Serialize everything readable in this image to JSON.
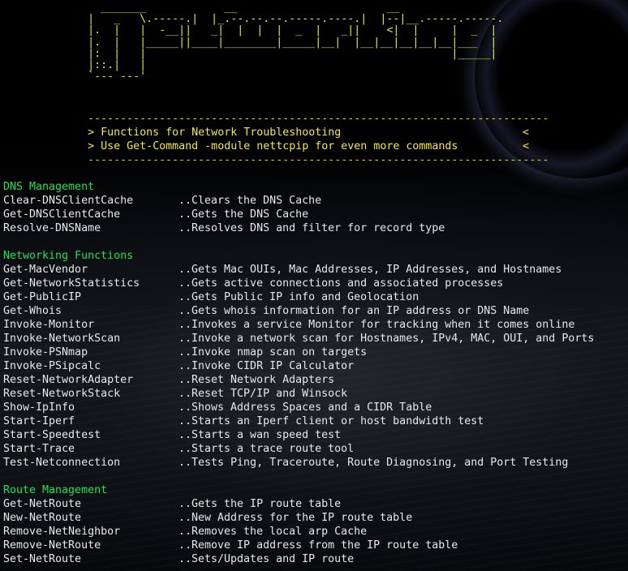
{
  "logo_lines": [
    "               _______            __                       __",
    "             |   _   \\.-----.|  |_.--.--.--.-----.----.|  |--|__.-----.-----.",
    "             |.  |   |  -__||   _|  |  |  |  _  |   _||    <|  |     |  _  |",
    "             |.  |   |_____||____|________|_____|__|  |__|__|__|__|__|___  |",
    "             |:  |   |                                               |_____|",
    "             |::.|   |",
    "             `--- ---'"
  ],
  "banner": {
    "separator": "             -----------------------------------------------------------------------",
    "row1_marker": "> ",
    "row1_text": "Functions for Network Troubleshooting",
    "row1_end": "<",
    "row2_marker": "> ",
    "row2_text": "Use Get-Command -module nettcpip for even more commands",
    "row2_end": "<"
  },
  "sections": [
    {
      "title": "DNS Management",
      "commands": [
        {
          "name": "Clear-DNSClientCache",
          "desc": "..Clears the DNS Cache"
        },
        {
          "name": "Get-DNSClientCache",
          "desc": "..Gets the DNS Cache"
        },
        {
          "name": "Resolve-DNSName",
          "desc": "..Resolves DNS and filter for record type"
        }
      ]
    },
    {
      "title": "Networking Functions",
      "commands": [
        {
          "name": "Get-MacVendor",
          "desc": "..Gets Mac OUIs, Mac Addresses, IP Addresses, and Hostnames"
        },
        {
          "name": "Get-NetworkStatistics",
          "desc": "..Gets active connections and associated processes"
        },
        {
          "name": "Get-PublicIP",
          "desc": "..Gets Public IP info and Geolocation"
        },
        {
          "name": "Get-Whois",
          "desc": "..Gets whois information for an IP address or DNS Name"
        },
        {
          "name": "Invoke-Monitor",
          "desc": "..Invokes a service Monitor for tracking when it comes online"
        },
        {
          "name": "Invoke-NetworkScan",
          "desc": "..Invoke a network scan for Hostnames, IPv4, MAC, OUI, and Ports"
        },
        {
          "name": "Invoke-PSNmap",
          "desc": "..Invoke nmap scan on targets"
        },
        {
          "name": "Invoke-PSipcalc",
          "desc": "..Invoke CIDR IP Calculator"
        },
        {
          "name": "Reset-NetworkAdapter",
          "desc": "..Reset Network Adapters"
        },
        {
          "name": "Reset-NetworkStack",
          "desc": "..Reset TCP/IP and Winsock"
        },
        {
          "name": "Show-IpInfo",
          "desc": "..Shows Address Spaces and a CIDR Table"
        },
        {
          "name": "Start-Iperf",
          "desc": "..Starts an Iperf client or host bandwidth test"
        },
        {
          "name": "Start-Speedtest",
          "desc": "..Starts a wan speed test"
        },
        {
          "name": "Start-Trace",
          "desc": "..Starts a trace route tool"
        },
        {
          "name": "Test-Netconnection",
          "desc": "..Tests Ping, Traceroute, Route Diagnosing, and Port Testing"
        }
      ]
    },
    {
      "title": "Route Management",
      "commands": [
        {
          "name": "Get-NetRoute",
          "desc": "..Gets the IP route table"
        },
        {
          "name": "New-NetRoute",
          "desc": "..New Address for the IP route table"
        },
        {
          "name": "Remove-NetNeighbor",
          "desc": "..Removes the local arp Cache"
        },
        {
          "name": "Remove-NetRoute",
          "desc": "..Remove IP address from the IP route table"
        },
        {
          "name": "Set-NetRoute",
          "desc": "..Sets/Updates and IP route"
        }
      ]
    }
  ],
  "colors": {
    "logo": "#d7ee2f",
    "banner_text": "#f2e84a",
    "separator": "#d7d700",
    "section_heading": "#22e05a",
    "body_text": "#e8e8e8",
    "background": "#000000"
  }
}
